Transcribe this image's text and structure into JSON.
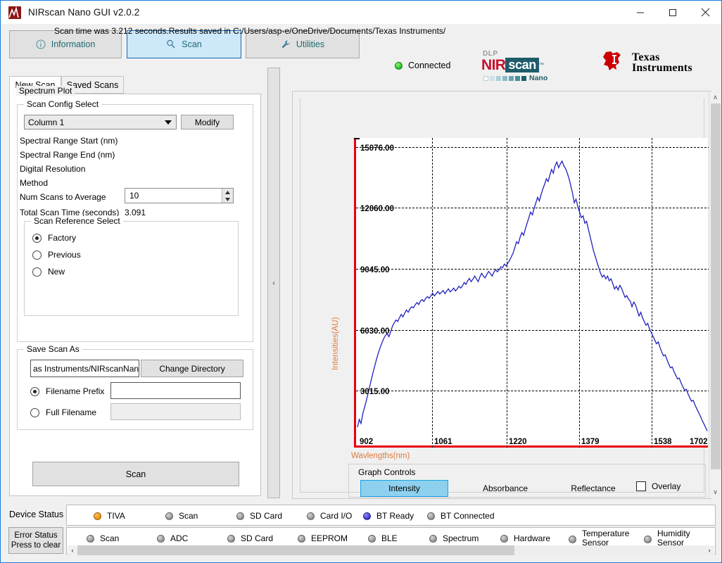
{
  "window": {
    "title": "NIRscan Nano GUI v2.0.2",
    "minimize": "—",
    "maximize": "☐",
    "close": "✕"
  },
  "toolbar": {
    "information": "Information",
    "scan": "Scan",
    "utilities": "Utilities",
    "connection_status": "Connected",
    "connection_color": "#1dbd1d"
  },
  "branding": {
    "dlp": "DLP",
    "nir": "NIR",
    "scan": "scan",
    "tm": "™",
    "nano": "Nano",
    "ti_line1": "Texas",
    "ti_line2": "Instruments",
    "nir_red": "#c8102e",
    "nir_teal": "#1f5c6b",
    "ti_red": "#cc0000"
  },
  "left_panel": {
    "tabs": [
      {
        "label": "New Scan",
        "selected": true
      },
      {
        "label": "Saved Scans",
        "selected": false
      }
    ],
    "scan_config": {
      "group_label": "Scan Config Select",
      "selected_config": "Column 1",
      "modify_label": "Modify",
      "fields": [
        {
          "label": "Spectral Range Start (nm)",
          "value": ""
        },
        {
          "label": "Spectral Range End (nm)",
          "value": ""
        },
        {
          "label": "Digital Resolution",
          "value": ""
        },
        {
          "label": "Method",
          "value": ""
        }
      ],
      "num_scans_label": "Num Scans to Average",
      "num_scans_value": "10",
      "total_time_label": "Total Scan Time (seconds)",
      "total_time_value": "3.091"
    },
    "scan_reference": {
      "group_label": "Scan Reference Select",
      "options": [
        {
          "label": "Factory",
          "selected": true
        },
        {
          "label": "Previous",
          "selected": false
        },
        {
          "label": "New",
          "selected": false
        }
      ]
    },
    "save_scan_as": {
      "group_label": "Save Scan As",
      "directory_value": "as Instruments/NIRscanNano",
      "change_directory_label": "Change Directory",
      "filename_prefix_label": "Filename Prefix",
      "filename_prefix_value": "",
      "filename_prefix_selected": true,
      "full_filename_label": "Full Filename",
      "full_filename_value": "",
      "full_filename_selected": false
    },
    "scan_button": "Scan"
  },
  "splitter": {
    "collapse_arrow": "‹"
  },
  "plot_panel": {
    "group_label": "Spectrum Plot",
    "scan_time_text": "Scan time was 3.212 seconds.Results saved in C:/Users/asp-e/OneDrive/Documents/Texas Instruments/",
    "graph_controls": {
      "group_label": "Graph Controls",
      "intensity": "Intensity",
      "absorbance": "Absorbance",
      "reflectance": "Reflectance",
      "overlay": "Overlay",
      "selected": "Intensity",
      "overlay_checked": false
    },
    "scrollbar": {
      "up": "∧",
      "down": "∨"
    }
  },
  "chart_data": {
    "type": "line",
    "title": "",
    "xlabel": "Wavlengths(nm)",
    "ylabel": "Intensities(AU)",
    "xlim": [
      902,
      1702
    ],
    "ylim": [
      0,
      16700
    ],
    "grid": true,
    "legend": "none",
    "axis_color": "#e8000d",
    "series_color": "#2020c0",
    "xticks": [
      902,
      1061,
      1220,
      1379,
      1538,
      1702
    ],
    "yticks": [
      "3015.00",
      "6030.00",
      "9045.00",
      "12060.00",
      "15076.00"
    ],
    "ytick_values": [
      3015,
      6030,
      9045,
      12060,
      15076
    ],
    "series": [
      {
        "name": "Intensity",
        "x": [
          902,
          906,
          910,
          914,
          918,
          922,
          926,
          930,
          934,
          938,
          942,
          946,
          950,
          954,
          958,
          962,
          966,
          970,
          974,
          978,
          982,
          986,
          990,
          994,
          998,
          1002,
          1006,
          1010,
          1014,
          1018,
          1022,
          1026,
          1030,
          1034,
          1038,
          1042,
          1046,
          1050,
          1054,
          1058,
          1062,
          1066,
          1070,
          1074,
          1078,
          1082,
          1086,
          1090,
          1094,
          1098,
          1102,
          1106,
          1110,
          1114,
          1118,
          1122,
          1126,
          1130,
          1134,
          1138,
          1142,
          1146,
          1150,
          1154,
          1158,
          1162,
          1166,
          1170,
          1174,
          1178,
          1182,
          1186,
          1190,
          1194,
          1198,
          1202,
          1206,
          1210,
          1214,
          1218,
          1222,
          1226,
          1230,
          1234,
          1238,
          1242,
          1246,
          1250,
          1254,
          1258,
          1262,
          1266,
          1270,
          1274,
          1278,
          1282,
          1286,
          1290,
          1294,
          1298,
          1302,
          1306,
          1310,
          1314,
          1318,
          1322,
          1326,
          1330,
          1334,
          1338,
          1342,
          1346,
          1350,
          1354,
          1358,
          1362,
          1366,
          1370,
          1374,
          1378,
          1382,
          1386,
          1390,
          1394,
          1398,
          1402,
          1406,
          1410,
          1414,
          1418,
          1422,
          1426,
          1430,
          1434,
          1438,
          1442,
          1446,
          1450,
          1454,
          1458,
          1462,
          1466,
          1470,
          1474,
          1478,
          1482,
          1486,
          1490,
          1494,
          1498,
          1502,
          1506,
          1510,
          1514,
          1518,
          1522,
          1526,
          1530,
          1534,
          1538,
          1542,
          1546,
          1550,
          1554,
          1558,
          1562,
          1566,
          1570,
          1574,
          1578,
          1582,
          1586,
          1590,
          1594,
          1598,
          1602,
          1606,
          1610,
          1614,
          1618,
          1622,
          1626,
          1630,
          1634,
          1638,
          1642,
          1646,
          1650,
          1654,
          1658,
          1662,
          1666,
          1670,
          1674,
          1678,
          1682,
          1686,
          1690,
          1694,
          1698,
          1702
        ],
        "y": [
          1100,
          1520,
          1300,
          1820,
          2150,
          2500,
          2900,
          3300,
          3700,
          4100,
          4450,
          4800,
          5120,
          5400,
          5650,
          5880,
          6050,
          6150,
          5980,
          6250,
          6550,
          6720,
          6880,
          6800,
          7000,
          7180,
          7050,
          7250,
          7420,
          7300,
          7480,
          7600,
          7540,
          7700,
          7820,
          7720,
          7900,
          7980,
          7880,
          8050,
          8140,
          8050,
          8200,
          8330,
          8180,
          8300,
          8420,
          8280,
          8380,
          8470,
          8300,
          8440,
          8560,
          8400,
          8480,
          8600,
          8450,
          8550,
          8700,
          8600,
          8720,
          8900,
          8800,
          9000,
          9120,
          8950,
          9080,
          9250,
          9100,
          8950,
          9200,
          9400,
          9250,
          9150,
          9350,
          9500,
          9380,
          9250,
          9450,
          9600,
          9480,
          9600,
          9750,
          9700,
          9900,
          9800,
          9950,
          10100,
          10300,
          10500,
          10800,
          11100,
          11000,
          11350,
          11600,
          11450,
          11800,
          12100,
          12400,
          12700,
          12550,
          12900,
          13200,
          13500,
          13300,
          13650,
          13950,
          14200,
          14500,
          14350,
          14700,
          15000,
          14800,
          15200,
          15400,
          15100,
          15300,
          15450,
          15200,
          15050,
          14800,
          14500,
          14100,
          13700,
          13200,
          13400,
          13000,
          12700,
          12400,
          12500,
          12100,
          12200,
          11800,
          11400,
          11000,
          10600,
          10300,
          10000,
          9700,
          9400,
          9200,
          9300,
          9100,
          9250,
          9000,
          9100,
          8850,
          8550,
          8700,
          8500,
          8750,
          8600,
          8350,
          8100,
          8200,
          8000,
          7900,
          7600,
          7850,
          7700,
          7400,
          7100,
          7300,
          7000,
          6800,
          6600,
          6700,
          6400,
          6200,
          6000,
          5800,
          5600,
          5700,
          5400,
          5150,
          4950,
          5000,
          4750,
          4500,
          4300,
          4350,
          4100,
          3900,
          3700,
          3750,
          3500,
          3300,
          3100,
          3150,
          2900,
          2700,
          2500,
          2550,
          2300,
          2100,
          1900,
          1700,
          1500,
          1300,
          1100,
          900,
          700,
          520
        ]
      }
    ]
  },
  "status_bar": {
    "device_status_label": "Device Status",
    "error_status_label_line1": "Error Status",
    "error_status_label_line2": "Press to clear",
    "device_items": [
      {
        "label": "TIVA",
        "state": "orange"
      },
      {
        "label": "Scan",
        "state": "grey"
      },
      {
        "label": "SD Card",
        "state": "grey"
      },
      {
        "label": "Card I/O",
        "state": "grey"
      },
      {
        "label": "BT Ready",
        "state": "blue"
      },
      {
        "label": "BT Connected",
        "state": "grey"
      }
    ],
    "error_items": [
      {
        "label": "Scan",
        "state": "grey",
        "line2": ""
      },
      {
        "label": "ADC",
        "state": "grey",
        "line2": ""
      },
      {
        "label": "SD Card",
        "state": "grey",
        "line2": ""
      },
      {
        "label": "EEPROM",
        "state": "grey",
        "line2": ""
      },
      {
        "label": "BLE",
        "state": "grey",
        "line2": ""
      },
      {
        "label": "Spectrum",
        "state": "grey",
        "line2": ""
      },
      {
        "label": "Hardware",
        "state": "grey",
        "line2": ""
      },
      {
        "label": "Temperature",
        "state": "grey",
        "line2": "Sensor"
      },
      {
        "label": "Humidity",
        "state": "grey",
        "line2": "Sensor"
      }
    ],
    "scroll_left": "‹",
    "scroll_right": "›"
  }
}
